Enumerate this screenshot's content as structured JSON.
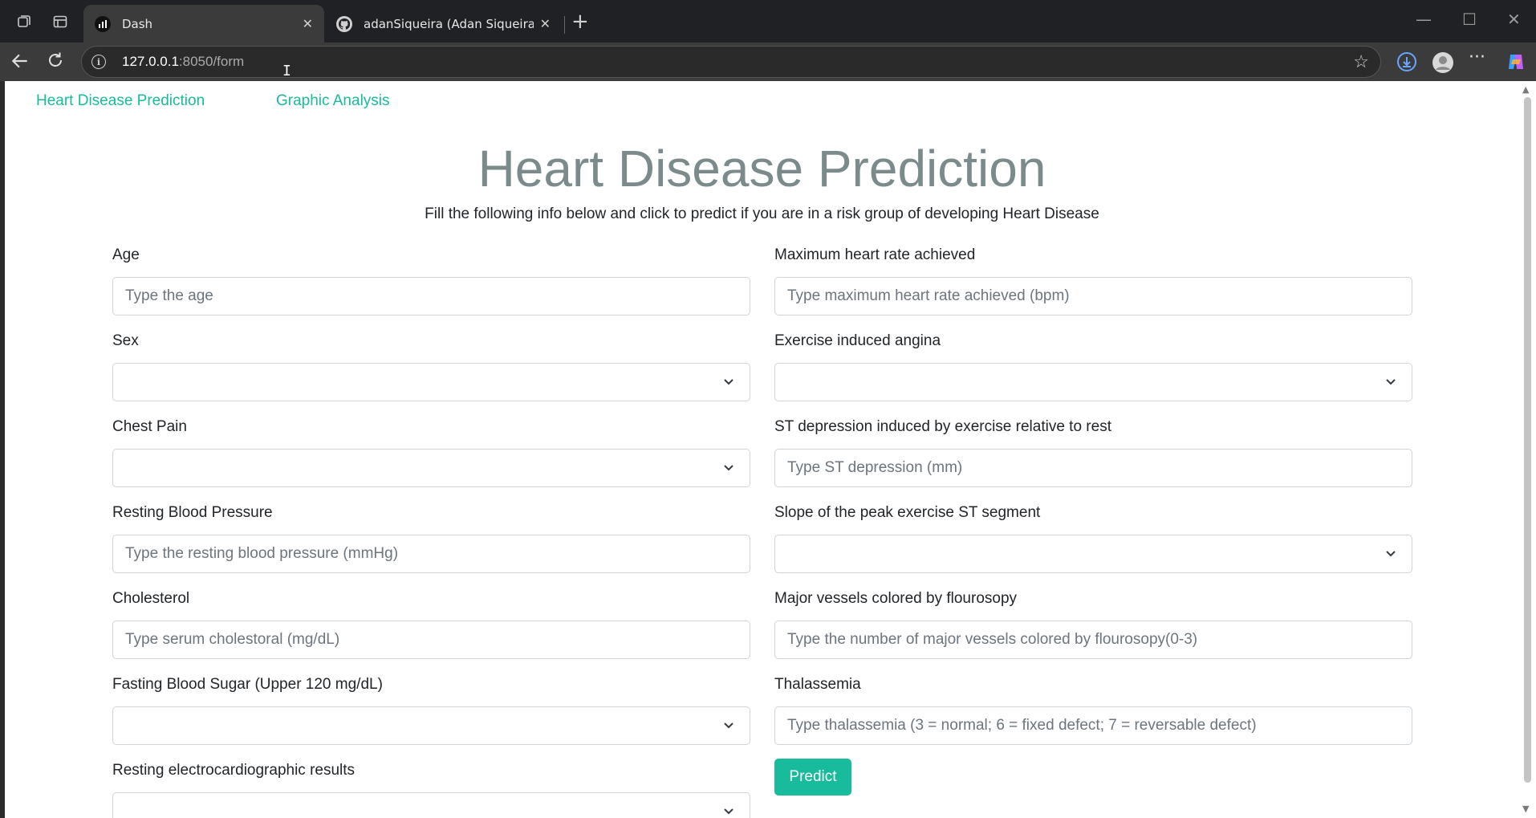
{
  "browser": {
    "tabs": [
      {
        "title": "Dash",
        "active": true,
        "favicon": "dash-chart-icon"
      },
      {
        "title": "adanSiqueira (Adan Siqueira)",
        "active": false,
        "favicon": "github-icon"
      }
    ],
    "url": {
      "host": "127.0.0.1",
      "path": ":8050/form"
    }
  },
  "nav": {
    "links": [
      "Heart Disease Prediction",
      "Graphic Analysis"
    ]
  },
  "page": {
    "title": "Heart Disease Prediction",
    "subtitle": "Fill the following info below and click to predict if you are in a risk group of developing Heart Disease"
  },
  "form": {
    "left": [
      {
        "label": "Age",
        "type": "input",
        "placeholder": "Type the age"
      },
      {
        "label": "Sex",
        "type": "select",
        "value": ""
      },
      {
        "label": "Chest Pain",
        "type": "select",
        "value": ""
      },
      {
        "label": "Resting Blood Pressure",
        "type": "input",
        "placeholder": "Type the resting blood pressure (mmHg)"
      },
      {
        "label": "Cholesterol",
        "type": "input",
        "placeholder": "Type serum cholestoral (mg/dL)"
      },
      {
        "label": "Fasting Blood Sugar (Upper 120 mg/dL)",
        "type": "select",
        "value": ""
      },
      {
        "label": "Resting electrocardiographic results",
        "type": "select",
        "value": ""
      }
    ],
    "right": [
      {
        "label": "Maximum heart rate achieved",
        "type": "input",
        "placeholder": "Type maximum heart rate achieved (bpm)"
      },
      {
        "label": "Exercise induced angina",
        "type": "select",
        "value": ""
      },
      {
        "label": "ST depression induced by exercise relative to rest",
        "type": "input",
        "placeholder": "Type ST depression (mm)"
      },
      {
        "label": "Slope of the peak exercise ST segment",
        "type": "select",
        "value": ""
      },
      {
        "label": "Major vessels colored by flourosopy",
        "type": "input",
        "placeholder": "Type the number of major vessels colored by flourosopy(0-3)"
      },
      {
        "label": "Thalassemia",
        "type": "input",
        "placeholder": "Type thalassemia (3 = normal; 6 = fixed defect; 7 = reversable defect)"
      }
    ],
    "submit_label": "Predict"
  },
  "colors": {
    "accent": "#18bc9c",
    "title": "#7b8a8b",
    "text": "#212529",
    "placeholder": "#6c757d",
    "border": "#ced4da"
  }
}
